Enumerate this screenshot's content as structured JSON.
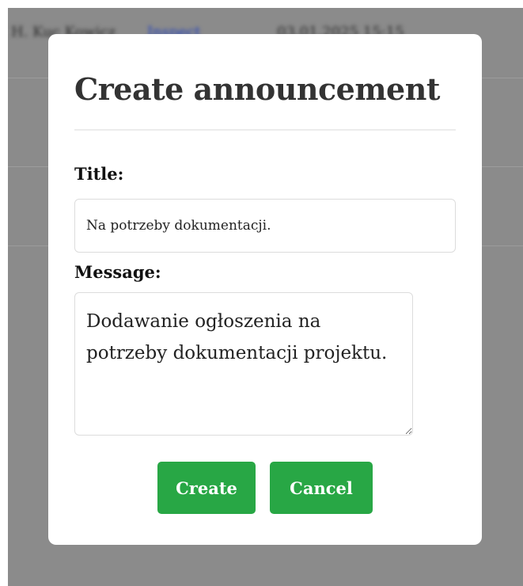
{
  "background": {
    "row1": {
      "author": "H. Kuc Kowicz",
      "link": "Inspect",
      "date": "03.01.2025 15:15"
    }
  },
  "modal": {
    "title": "Create announcement",
    "title_label": "Title:",
    "title_value": "Na potrzeby dokumentacji.",
    "message_label": "Message:",
    "message_value": "Dodawanie ogłoszenia na potrzeby dokumentacji projektu.",
    "create_label": "Create",
    "cancel_label": "Cancel"
  },
  "colors": {
    "overlay": "#8b8b8b",
    "button": "#28a745",
    "heading": "#333333"
  }
}
